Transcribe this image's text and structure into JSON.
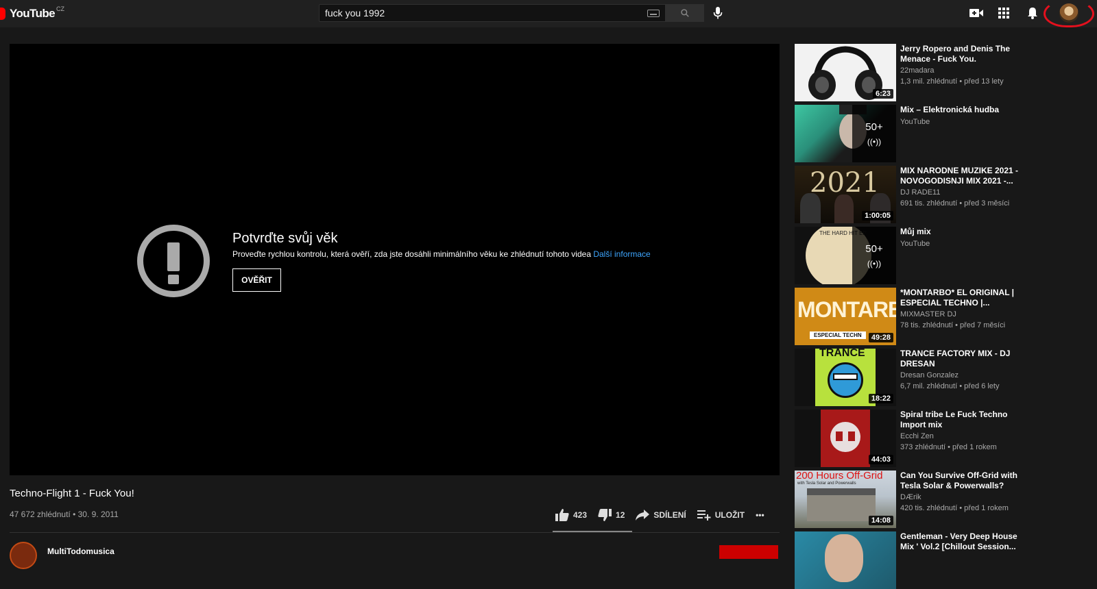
{
  "header": {
    "logo_text": "YouTube",
    "country": "CZ",
    "search_value": "fuck you 1992"
  },
  "player": {
    "age_title": "Potvrďte svůj věk",
    "age_desc": "Proveďte rychlou kontrolu, která ověří, zda jste dosáhli minimálního věku ke zhlédnutí tohoto videa",
    "age_link": "Další informace",
    "verify_label": "OVĚŘIT"
  },
  "video": {
    "title": "Techno-Flight 1 - Fuck You!",
    "meta": "47 672 zhlédnutí • 30. 9. 2011",
    "likes": "423",
    "dislikes": "12",
    "share_label": "SDÍLENÍ",
    "save_label": "ULOŽIT",
    "more_label": "•••",
    "channel": "MultiTodomusica"
  },
  "recommendations": [
    {
      "title": "Jerry Ropero and Denis The Menace - Fuck You.",
      "channel": "22madara",
      "stats": "1,3 mil. zhlédnutí • před 13 lety",
      "duration": "6:23"
    },
    {
      "title": "Mix – Elektronická hudba",
      "channel": "YouTube",
      "stats": "",
      "mix_count": "50+",
      "mix_icon": "((•))"
    },
    {
      "title": "MIX NARODNE MUZIKE 2021 - NOVOGODISNJI MIX 2021 -...",
      "channel": "DJ RADE11",
      "stats": "691 tis. zhlédnutí • před 3 měsíci",
      "duration": "1:00:05",
      "thumb_text": "2021"
    },
    {
      "title": "Můj mix",
      "channel": "YouTube",
      "stats": "",
      "mix_count": "50+",
      "mix_icon": "((•))",
      "thumb_text": "THE HARD HIT EP"
    },
    {
      "title": "*MONTARBO* EL ORIGINAL | ESPECIAL TECHNO |...",
      "channel": "MIXMASTER DJ",
      "stats": "78 tis. zhlédnutí • před 7 měsíci",
      "duration": "49:28",
      "thumb_text": "MONTARBO",
      "thumb_sub": "ESPECIAL TECHN"
    },
    {
      "title": "TRANCE FACTORY MIX - DJ DRESAN",
      "channel": "Dresan Gonzalez",
      "stats": "6,7 mil. zhlédnutí • před 6 lety",
      "duration": "18:22",
      "thumb_text": "TRANCE"
    },
    {
      "title": "Spiral tribe Le Fuck Techno Import mix",
      "channel": "Ecchi Zen",
      "stats": "373 zhlédnutí • před 1 rokem",
      "duration": "44:03"
    },
    {
      "title": "Can You Survive Off-Grid with Tesla Solar & Powerwalls?",
      "channel": "DÆrik",
      "stats": "420 tis. zhlédnutí • před 1 rokem",
      "duration": "14:08",
      "thumb_text": "200 Hours Off-Grid",
      "thumb_sub": "with Tesla Solar and Powerwalls"
    },
    {
      "title": "Gentleman - Very Deep House Mix ' Vol.2 [Chillout Session...",
      "channel": "",
      "stats": ""
    }
  ]
}
